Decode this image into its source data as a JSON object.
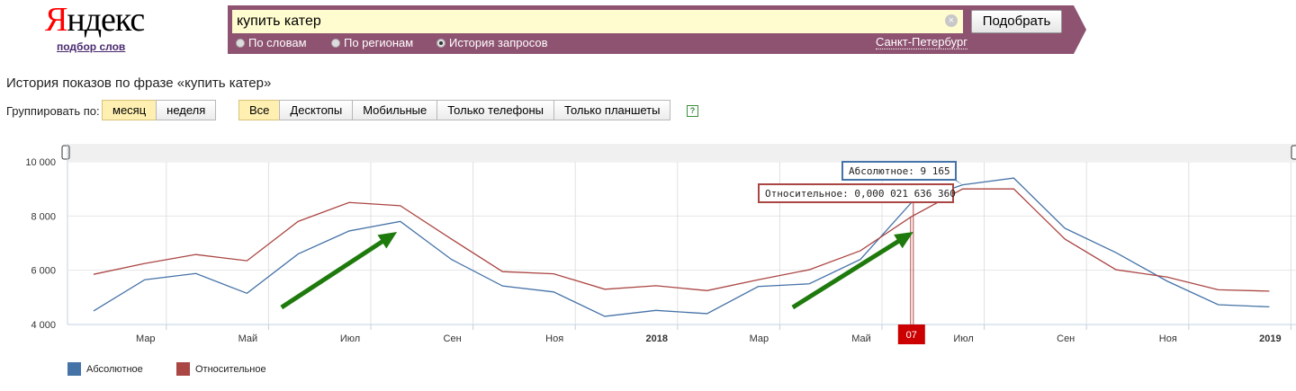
{
  "header": {
    "logo_first": "Я",
    "logo_rest": "ндекс",
    "sublink": "подбор слов",
    "search_value": "купить катер",
    "submit_label": "Подобрать",
    "radio_words": "По словам",
    "radio_regions": "По регионам",
    "radio_history": "История запросов",
    "region": "Санкт-Петербург"
  },
  "controls": {
    "group_label": "Группировать по:",
    "group_month": "месяц",
    "group_week": "неделя",
    "dev_all": "Все",
    "dev_desktop": "Десктопы",
    "dev_mobile": "Мобильные",
    "dev_phones": "Только телефоны",
    "dev_tablets": "Только планшеты",
    "help": "?"
  },
  "colors": {
    "absolute": "#4572a7",
    "relative": "#aa4643",
    "accent": "#8e5371",
    "selected_marker": "#cc0000",
    "arrow": "#1e7a0c"
  },
  "chart_data": {
    "type": "line",
    "title": "История показов по фразе «купить катер»",
    "ylim": [
      4000,
      10000
    ],
    "yticks": [
      "10 000",
      "8 000",
      "6 000",
      "4 000"
    ],
    "ytick_values": [
      10000,
      8000,
      6000,
      4000
    ],
    "x": [
      "2017-02",
      "2017-03",
      "2017-04",
      "2017-05",
      "2017-06",
      "2017-07",
      "2017-08",
      "2017-09",
      "2017-10",
      "2017-11",
      "2017-12",
      "2018-01",
      "2018-02",
      "2018-03",
      "2018-04",
      "2018-05",
      "2018-06",
      "2018-07",
      "2018-08",
      "2018-09",
      "2018-10",
      "2018-11",
      "2018-12",
      "2019-01"
    ],
    "xtick_labels": [
      "Мар",
      "Май",
      "Июл",
      "Сен",
      "Ноя",
      "2018",
      "Мар",
      "Май",
      "Июл",
      "Сен",
      "Ноя",
      "2019"
    ],
    "xtick_dates": [
      "2017-03",
      "2017-05",
      "2017-07",
      "2017-09",
      "2017-11",
      "2018-01",
      "2018-03",
      "2018-05",
      "2018-07",
      "2018-09",
      "2018-11",
      "2019-01"
    ],
    "xtick_bold": [
      false,
      false,
      false,
      false,
      false,
      true,
      false,
      false,
      false,
      false,
      false,
      true
    ],
    "series": [
      {
        "name": "Абсолютное",
        "color": "#4572a7",
        "values": [
          4500,
          5650,
          5880,
          5150,
          6600,
          7450,
          7800,
          6400,
          5420,
          5200,
          4300,
          4520,
          4400,
          5400,
          5500,
          6400,
          8500,
          9150,
          9400,
          7550,
          6650,
          5600,
          4730,
          4650
        ]
      },
      {
        "name": "Относительное",
        "color": "#aa4643",
        "values": [
          5850,
          6250,
          6580,
          6350,
          7800,
          8500,
          8380,
          7150,
          5950,
          5870,
          5300,
          5430,
          5250,
          5650,
          6020,
          6720,
          7980,
          9000,
          9000,
          7150,
          6020,
          5750,
          5280,
          5230
        ]
      }
    ],
    "selected_index": 16,
    "selected_label": "07",
    "tooltip_absolute": "Абсолютное: 9 165",
    "tooltip_relative": "Относительное: 0,000 021 636 360",
    "arrows": [
      {
        "from": 3.5,
        "to": 6.2
      },
      {
        "from": 13.5,
        "to": 16.3
      }
    ],
    "legend_position": "bottom-left",
    "grid": true
  }
}
